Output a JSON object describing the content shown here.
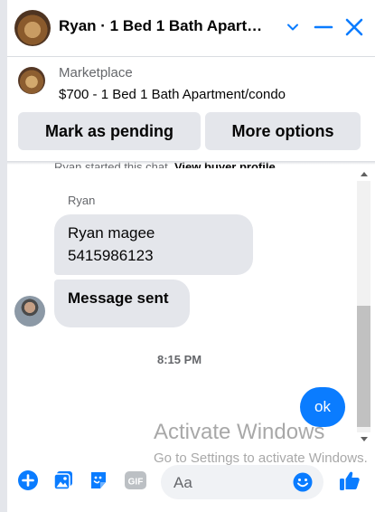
{
  "header": {
    "title": "Ryan · 1 Bed 1 Bath Apart…"
  },
  "listing": {
    "label": "Marketplace",
    "title": "$700 - 1 Bed 1 Bath Apartment/condo",
    "actions": [
      "Mark as pending",
      "More options"
    ]
  },
  "thread": {
    "cutoff_prefix": "Ryan started this chat.",
    "cutoff_link": "View buyer profile",
    "sender_name": "Ryan",
    "message_1": [
      "Ryan magee",
      "5415986123"
    ],
    "message_2": "Message sent",
    "timestamp": "8:15 PM",
    "outgoing": "ok"
  },
  "watermark": {
    "line1": "Activate Windows",
    "line2": "Go to Settings to activate Windows."
  },
  "composer": {
    "placeholder": "Aa"
  },
  "icons": [
    "chevron-down-icon",
    "minimize-icon",
    "close-icon",
    "plus-circle-icon",
    "photo-icon",
    "sticker-icon",
    "gif-icon",
    "emoji-icon",
    "thumbs-up-icon",
    "scroll-up-arrow-icon",
    "scroll-down-arrow-icon"
  ],
  "colors": {
    "accent": "#0a7cff",
    "bubble_in": "#e4e6eb",
    "button_bg": "#e4e6eb",
    "muted_text": "#65676b"
  }
}
